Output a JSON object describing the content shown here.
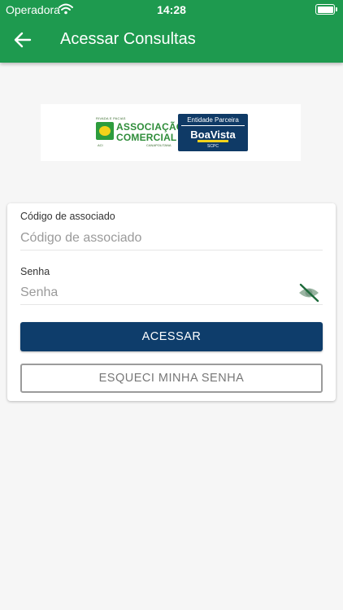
{
  "status_bar": {
    "carrier": "Operadora",
    "time": "14:28",
    "wifi_icon": "wifi-icon",
    "battery_icon": "battery-icon"
  },
  "header": {
    "title": "Acessar Consultas",
    "back_icon": "arrow-left-icon",
    "color": "#1e9a4f"
  },
  "logos": {
    "association": {
      "top_small": "RIVADA E PACIAS",
      "line1": "ASSOCIAÇÃO",
      "line2": "COMERCIAL",
      "sub_left": "ACI",
      "sub_right": "CANAPOLITANA"
    },
    "boavista": {
      "tagline": "Entidade Parceira",
      "name": "BoaVista",
      "sub": "SCPC"
    }
  },
  "form": {
    "code": {
      "label": "Código de associado",
      "placeholder": "Código de associado",
      "value": ""
    },
    "password": {
      "label": "Senha",
      "placeholder": "Senha",
      "value": "",
      "toggle_icon": "eye-slash-icon"
    },
    "submit_label": "ACESSAR",
    "forgot_label": "ESQUECI MINHA SENHA"
  },
  "colors": {
    "primary_button": "#0e3d6b",
    "header": "#1e9a4f",
    "background": "#f6f6f6"
  }
}
